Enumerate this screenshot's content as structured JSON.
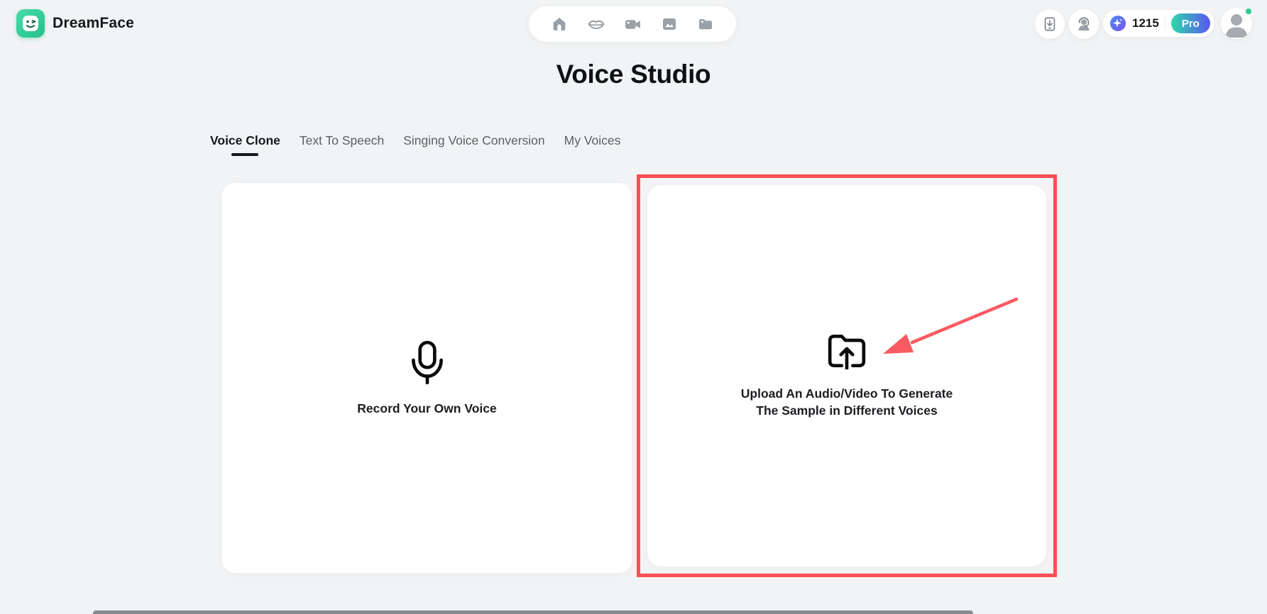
{
  "brand": {
    "name": "DreamFace"
  },
  "header": {
    "nav_icons": [
      "home-icon",
      "lips-icon",
      "video-camera-icon",
      "image-icon",
      "folder-icon"
    ],
    "action_icons": [
      "app-download-icon",
      "support-agent-icon"
    ],
    "credits": "1215",
    "plan_label": "Pro",
    "avatar_status": "online"
  },
  "page": {
    "title": "Voice Studio"
  },
  "tabs": [
    {
      "label": "Voice Clone",
      "active": true
    },
    {
      "label": "Text To Speech",
      "active": false
    },
    {
      "label": "Singing Voice Conversion",
      "active": false
    },
    {
      "label": "My Voices",
      "active": false
    }
  ],
  "cards": {
    "record": {
      "icon": "microphone-icon",
      "label": "Record Your Own Voice"
    },
    "upload": {
      "icon": "folder-upload-icon",
      "line1": "Upload An Audio/Video To Generate",
      "line2": "The Sample in Different Voices",
      "highlighted": true
    }
  },
  "annotation": {
    "type": "red-arrow",
    "points_to": "folder-upload-icon"
  },
  "colors": {
    "page_bg": "#f2f3f4",
    "card_bg": "#ffffff",
    "brand_green": "#2fc994",
    "icon_gray": "#9aa0a6",
    "text_dark": "#17181c",
    "tab_inactive": "#5c6066",
    "accent_red": "#fa4f55",
    "pro_gradient_start": "#2fd8a8",
    "pro_gradient_end": "#5a55f2",
    "sparkle_gradient_start": "#4a8bf5",
    "sparkle_gradient_end": "#7a52f2",
    "online_dot_green": "#2ecc8f"
  }
}
